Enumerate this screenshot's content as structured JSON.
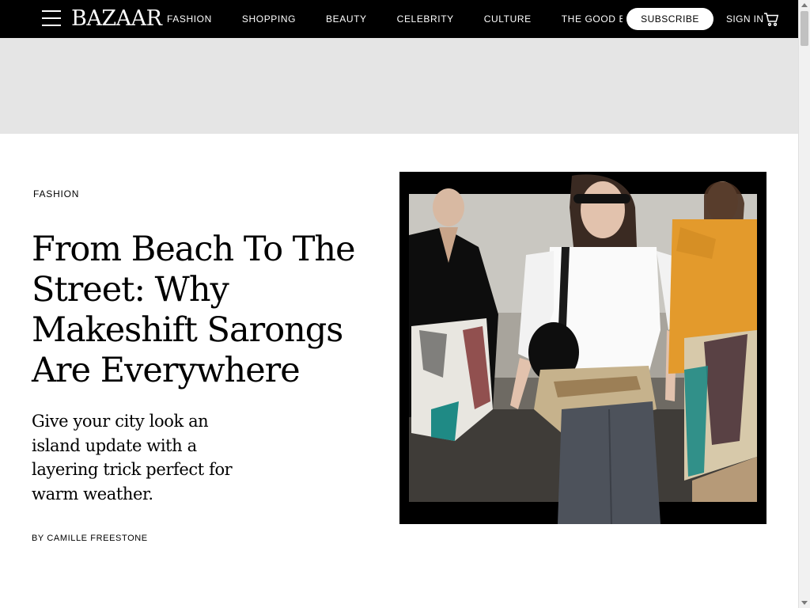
{
  "header": {
    "logo": "BAZAAR",
    "nav": [
      "FASHION",
      "SHOPPING",
      "BEAUTY",
      "CELEBRITY",
      "CULTURE",
      "THE GOOD BUY"
    ],
    "subscribe_label": "SUBSCRIBE",
    "signin_label": "SIGN IN"
  },
  "article": {
    "category": "FASHION",
    "title": "From Beach To The Street: Why Makeshift Sarongs Are Everywhere",
    "dek": "Give your city look an island update with a layering trick perfect for warm weather.",
    "byline_prefix": "BY ",
    "author": "CAMILLE FREESTONE"
  },
  "icons": {
    "menu": "hamburger-icon",
    "cart": "cart-icon"
  },
  "colors": {
    "nav_bg": "#000000",
    "ad_band": "#e5e5e5",
    "subscribe_bg": "#ffffff"
  }
}
